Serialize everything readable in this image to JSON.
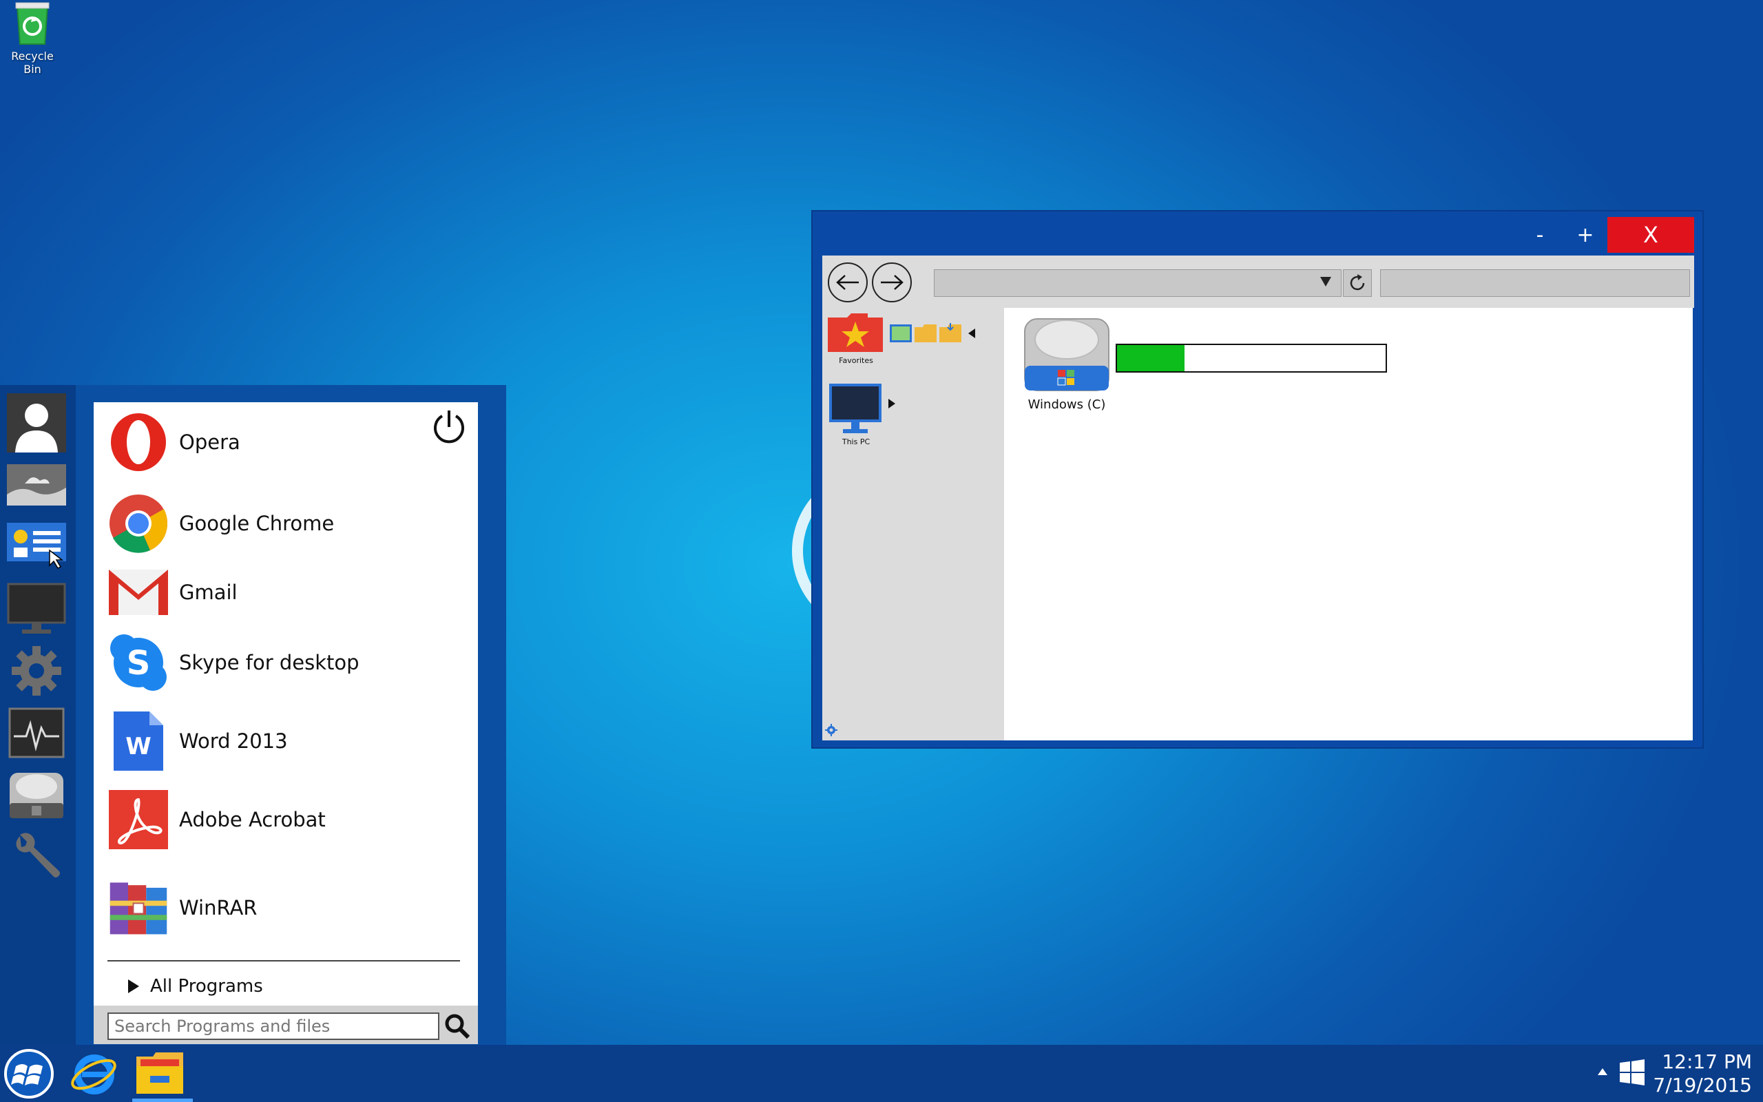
{
  "desktop": {
    "recycle_bin_label": "Recycle Bin"
  },
  "start_menu": {
    "apps": [
      {
        "label": "Opera",
        "icon": "opera-icon"
      },
      {
        "label": "Google Chrome",
        "icon": "chrome-icon"
      },
      {
        "label": "Gmail",
        "icon": "gmail-icon"
      },
      {
        "label": "Skype for desktop",
        "icon": "skype-icon"
      },
      {
        "label": "Word 2013",
        "icon": "word-icon"
      },
      {
        "label": "Adobe Acrobat",
        "icon": "acrobat-icon"
      },
      {
        "label": "WinRAR",
        "icon": "winrar-icon"
      }
    ],
    "all_programs_label": "All Programs",
    "search_placeholder": "Search Programs and files",
    "rail_icons": [
      "user-icon",
      "pictures-icon",
      "control-panel-icon",
      "monitor-icon",
      "settings-gear-icon",
      "activity-monitor-icon",
      "drive-icon",
      "wrench-icon"
    ]
  },
  "explorer": {
    "minimize_label": "-",
    "maximize_label": "+",
    "close_label": "X",
    "nav_pane": {
      "favorites_label": "Favorites",
      "this_pc_label": "This PC"
    },
    "drive": {
      "label": "Windows (C)",
      "used_fraction": 0.25
    }
  },
  "taskbar": {
    "time": "12:17 PM",
    "date": "7/19/2015"
  },
  "colors": {
    "window_blue": "#0b49a6",
    "close_red": "#e0131d",
    "progress_green": "#0dbd1b",
    "taskbar": "#0a3d8a"
  }
}
